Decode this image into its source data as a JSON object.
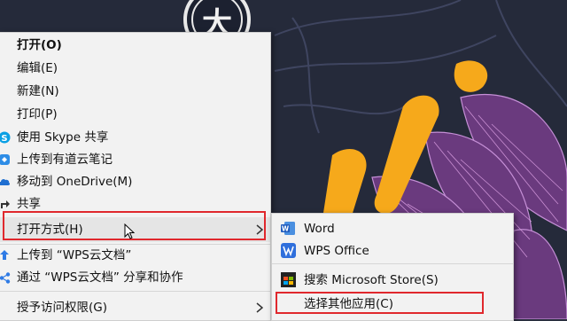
{
  "context_menu": {
    "items": [
      {
        "label": "打开(O)",
        "icon": "none",
        "bold": true
      },
      {
        "label": "编辑(E)",
        "icon": "none"
      },
      {
        "label": "新建(N)",
        "icon": "none"
      },
      {
        "label": "打印(P)",
        "icon": "none"
      },
      {
        "label": "使用 Skype 共享",
        "icon": "skype-icon"
      },
      {
        "label": "上传到有道云笔记",
        "icon": "youdao-note-icon"
      },
      {
        "label": "移动到 OneDrive(M)",
        "icon": "onedrive-cloud-icon"
      },
      {
        "label": "共享",
        "icon": "share-icon"
      },
      {
        "label": "打开方式(H)",
        "icon": "none",
        "submenu": true,
        "highlighted": true
      },
      {
        "label": "上传到 “WPS云文档”",
        "icon": "wps-cloud-upload-icon"
      },
      {
        "label": "通过 “WPS云文档” 分享和协作",
        "icon": "wps-cloud-share-icon"
      },
      {
        "label": "授予访问权限(G)",
        "icon": "none",
        "submenu": true
      }
    ]
  },
  "open_with_submenu": {
    "items": [
      {
        "label": "Word",
        "icon": "word-icon"
      },
      {
        "label": "WPS Office",
        "icon": "wps-office-icon"
      },
      {
        "label": "搜索 Microsoft Store(S)",
        "icon": "microsoft-store-icon"
      },
      {
        "label": "选择其他应用(C)",
        "icon": "none"
      }
    ]
  },
  "colors": {
    "menu_bg": "#f2f2f2",
    "highlight_box": "#e0282d",
    "wallpaper_accent": "#f6a91b",
    "wallpaper_purple": "#7b3f8c"
  }
}
